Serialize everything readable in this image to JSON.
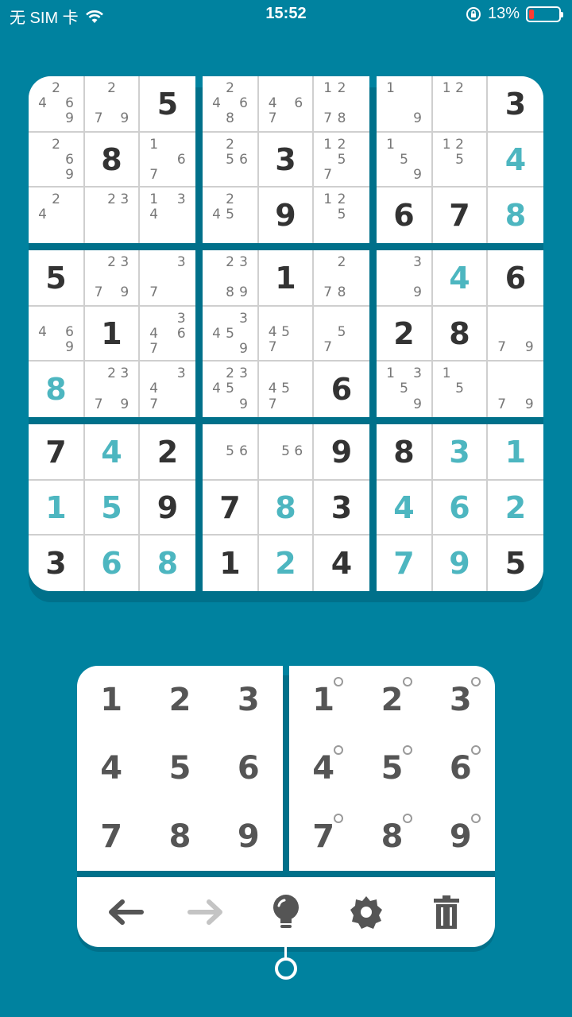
{
  "status_bar": {
    "carrier": "无 SIM 卡",
    "time": "15:52",
    "battery": "13%",
    "battery_level": 0.13
  },
  "colors": {
    "background": "#00829f",
    "given_digit": "#333333",
    "user_digit": "#4db6c0",
    "note_digit": "#777777"
  },
  "board": [
    [
      {
        "n": "2 469"
      },
      {
        "n": "2 79"
      },
      {
        "v": "5"
      },
      {
        "n": "2 468"
      },
      {
        "n": "46 7"
      },
      {
        "n": "12 78"
      },
      {
        "n": "1 9"
      },
      {
        "n": "12"
      },
      {
        "v": "3"
      }
    ],
    [
      {
        "n": "2 69"
      },
      {
        "v": "8"
      },
      {
        "n": "1 67"
      },
      {
        "n": "2 56"
      },
      {
        "v": "3"
      },
      {
        "n": "12 57"
      },
      {
        "n": "1 59"
      },
      {
        "n": "12 5"
      },
      {
        "v": "4",
        "u": true
      }
    ],
    [
      {
        "n": "2 4"
      },
      {
        "n": "23"
      },
      {
        "n": "13 4"
      },
      {
        "n": "2 45"
      },
      {
        "v": "9"
      },
      {
        "n": "12 5"
      },
      {
        "v": "6"
      },
      {
        "v": "7"
      },
      {
        "v": "8",
        "u": true
      }
    ],
    [
      {
        "v": "5"
      },
      {
        "n": "23 79"
      },
      {
        "n": "3 7"
      },
      {
        "n": "23 89"
      },
      {
        "v": "1"
      },
      {
        "n": "2 78"
      },
      {
        "n": "3 9"
      },
      {
        "v": "4",
        "u": true
      },
      {
        "v": "6"
      }
    ],
    [
      {
        "n": "46 9"
      },
      {
        "v": "1"
      },
      {
        "n": "3 467"
      },
      {
        "n": "3 45 9"
      },
      {
        "n": "45 7"
      },
      {
        "n": "5 7"
      },
      {
        "v": "2"
      },
      {
        "v": "8"
      },
      {
        "n": "79"
      }
    ],
    [
      {
        "v": "8",
        "u": true
      },
      {
        "n": "23 79"
      },
      {
        "n": "3 47"
      },
      {
        "n": "23 45 9"
      },
      {
        "n": "45 7"
      },
      {
        "v": "6"
      },
      {
        "n": "13 5 9"
      },
      {
        "n": "1 5"
      },
      {
        "n": "79"
      }
    ],
    [
      {
        "v": "7"
      },
      {
        "v": "4",
        "u": true
      },
      {
        "v": "2"
      },
      {
        "n": "56"
      },
      {
        "n": "56"
      },
      {
        "v": "9"
      },
      {
        "v": "8"
      },
      {
        "v": "3",
        "u": true
      },
      {
        "v": "1",
        "u": true
      }
    ],
    [
      {
        "v": "1",
        "u": true
      },
      {
        "v": "5",
        "u": true
      },
      {
        "v": "9"
      },
      {
        "v": "7"
      },
      {
        "v": "8",
        "u": true
      },
      {
        "v": "3"
      },
      {
        "v": "4",
        "u": true
      },
      {
        "v": "6",
        "u": true
      },
      {
        "v": "2",
        "u": true
      }
    ],
    [
      {
        "v": "3"
      },
      {
        "v": "6",
        "u": true
      },
      {
        "v": "8",
        "u": true
      },
      {
        "v": "1"
      },
      {
        "v": "2",
        "u": true
      },
      {
        "v": "4"
      },
      {
        "v": "7",
        "u": true
      },
      {
        "v": "9",
        "u": true
      },
      {
        "v": "5"
      }
    ]
  ],
  "number_pad": {
    "digits": [
      "1",
      "2",
      "3",
      "4",
      "5",
      "6",
      "7",
      "8",
      "9"
    ],
    "note_digits": [
      "1",
      "2",
      "3",
      "4",
      "5",
      "6",
      "7",
      "8",
      "9"
    ]
  },
  "toolbar": {
    "items": [
      {
        "icon": "undo-arrow-icon",
        "enabled": true
      },
      {
        "icon": "redo-arrow-icon",
        "enabled": false
      },
      {
        "icon": "hint-lightbulb-icon",
        "enabled": true
      },
      {
        "icon": "settings-gear-icon",
        "enabled": true
      },
      {
        "icon": "trash-icon",
        "enabled": true
      }
    ]
  }
}
